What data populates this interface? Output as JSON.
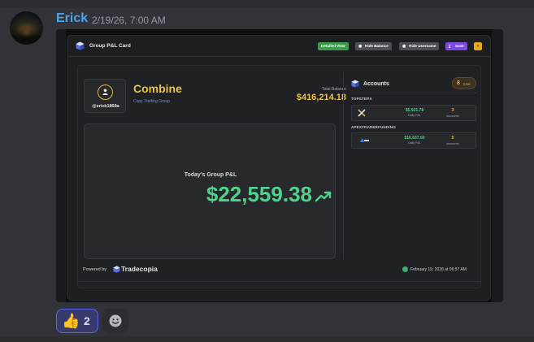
{
  "message": {
    "author": "Erick",
    "timestamp": "2/19/26, 7:00 AM",
    "avatar_icon": "profile-photo"
  },
  "card": {
    "header_title": "Group P&L Card",
    "buttons": {
      "detailed_view": "Detailed View",
      "hide_balance": "Hide Balance",
      "hide_username": "Hide Username",
      "save": "Save",
      "close": "×"
    },
    "profile": {
      "handle": "@erick1868a",
      "icon": "user-icon"
    },
    "group": {
      "name": "Combine",
      "subtitle": "Copy Trading Group"
    },
    "balance": {
      "label": "Total Balance",
      "value": "$416,214.18"
    },
    "pnl": {
      "label": "Today's Group P&L",
      "value": "$22,559.38",
      "trend_icon": "trend-up-icon"
    },
    "accounts": {
      "title": "Accounts",
      "total_count": "8",
      "total_label": "total",
      "firms": [
        {
          "name": "TOPSTEPX",
          "logo": "topstepx-logo",
          "amount": "$5,921.78",
          "amount_label": "Daily P&L",
          "count": "3",
          "count_label": "accounts"
        },
        {
          "name": "APEXTRADERFUNDING",
          "logo": "apex-logo",
          "amount": "$16,637.60",
          "amount_label": "Daily P&L",
          "count": "5",
          "count_label": "accounts"
        }
      ]
    },
    "footer": {
      "powered_by": "Powered by",
      "brand": "Tradecopia",
      "date": "February 19, 2026 at 06:57 AM"
    }
  },
  "reactions": [
    {
      "emoji": "👍",
      "count": "2"
    }
  ],
  "colors": {
    "accent_gold": "#e9c34a",
    "profit_green": "#4fd38a",
    "author_blue": "#4ea3e8",
    "save_purple": "#7b4ae0"
  }
}
